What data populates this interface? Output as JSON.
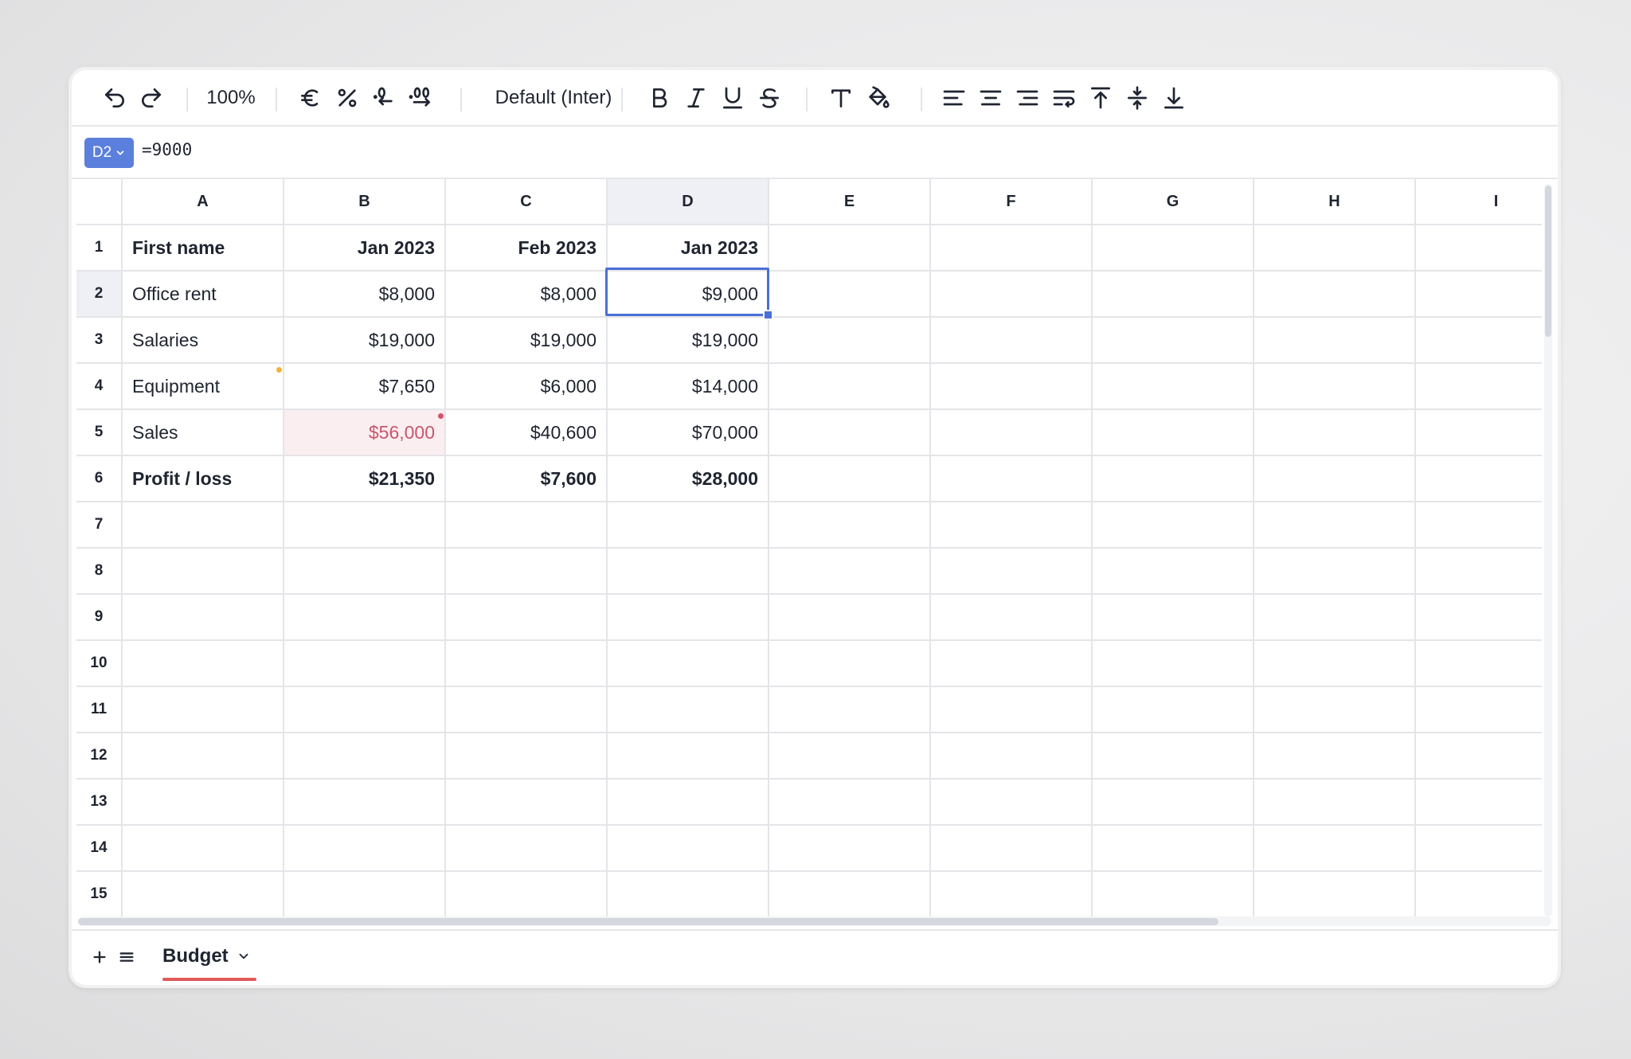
{
  "toolbar": {
    "zoom": "100%",
    "font": "Default (Inter)",
    "icons": [
      "undo-icon",
      "redo-icon",
      "euro-icon",
      "percent-icon",
      "decrease-decimal-icon",
      "increase-decimal-icon",
      "bold-icon",
      "italic-icon",
      "underline-icon",
      "strikethrough-icon",
      "text-color-icon",
      "fill-color-icon",
      "align-left-icon",
      "align-center-icon",
      "align-right-icon",
      "wrap-text-icon",
      "align-top-icon",
      "align-middle-icon",
      "align-bottom-icon"
    ]
  },
  "formula_bar": {
    "cell_ref": "D2",
    "formula": "=9000"
  },
  "sheet": {
    "columns": [
      "A",
      "B",
      "C",
      "D",
      "E",
      "F",
      "G",
      "H",
      "I"
    ],
    "active_column": "D",
    "active_row": "2",
    "row_numbers": [
      "1",
      "2",
      "3",
      "4",
      "5",
      "6",
      "7",
      "8",
      "9",
      "10",
      "11",
      "12",
      "13",
      "14",
      "15"
    ],
    "rows": [
      [
        "First name",
        "Jan 2023",
        "Feb 2023",
        "Jan 2023"
      ],
      [
        "Office rent",
        "$8,000",
        "$8,000",
        "$9,000"
      ],
      [
        "Salaries",
        "$19,000",
        "$19,000",
        "$19,000"
      ],
      [
        "Equipment",
        "$7,650",
        "$6,000",
        "$14,000"
      ],
      [
        "Sales",
        "$56,000",
        "$40,600",
        "$70,000"
      ],
      [
        "Profit / loss",
        "$21,350",
        "$7,600",
        "$28,000"
      ]
    ]
  },
  "tabs": {
    "sheets": [
      {
        "name": "Budget",
        "active": true
      }
    ]
  },
  "colors": {
    "accent": "#4a6fd6",
    "error_bg": "#fbeef0",
    "error_text": "#c9566c",
    "comment_dot": "#f0b43c",
    "error_dot": "#d9516a",
    "tab_underline": "#e05a5a"
  }
}
